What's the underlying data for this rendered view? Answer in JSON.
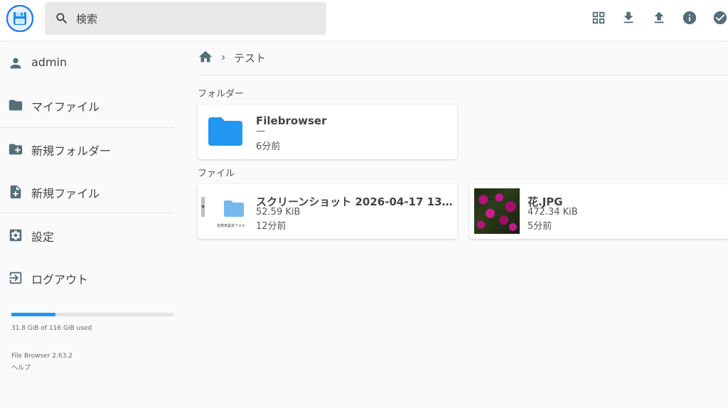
{
  "search": {
    "placeholder": "検索"
  },
  "sidebar": {
    "items": [
      {
        "label": "admin"
      },
      {
        "label": "マイファイル"
      },
      {
        "label": "新規フォルダー"
      },
      {
        "label": "新規ファイル"
      },
      {
        "label": "設定"
      },
      {
        "label": "ログアウト"
      }
    ],
    "usage": {
      "text": "31.8 GiB of 116 GiB used",
      "fraction": 0.274
    },
    "version": "File Browser 2.63.2",
    "help": "ヘルプ"
  },
  "breadcrumb": {
    "current": "テスト"
  },
  "sections": {
    "folders_title": "フォルダー",
    "files_title": "ファイル"
  },
  "folders": [
    {
      "name": "Filebrowser",
      "size": "—",
      "modified": "6分前"
    }
  ],
  "files": [
    {
      "name": "スクリーンショット 2026-04-17 13....",
      "size": "52.59 KiB",
      "modified": "12分前",
      "thumb_caption": "名称未設定フォル"
    },
    {
      "name": "花.JPG",
      "size": "472.34 KiB",
      "modified": "5分前"
    }
  ],
  "colors": {
    "accent": "#2196f3",
    "icon": "#546e7a",
    "folder": "#2196f3"
  }
}
